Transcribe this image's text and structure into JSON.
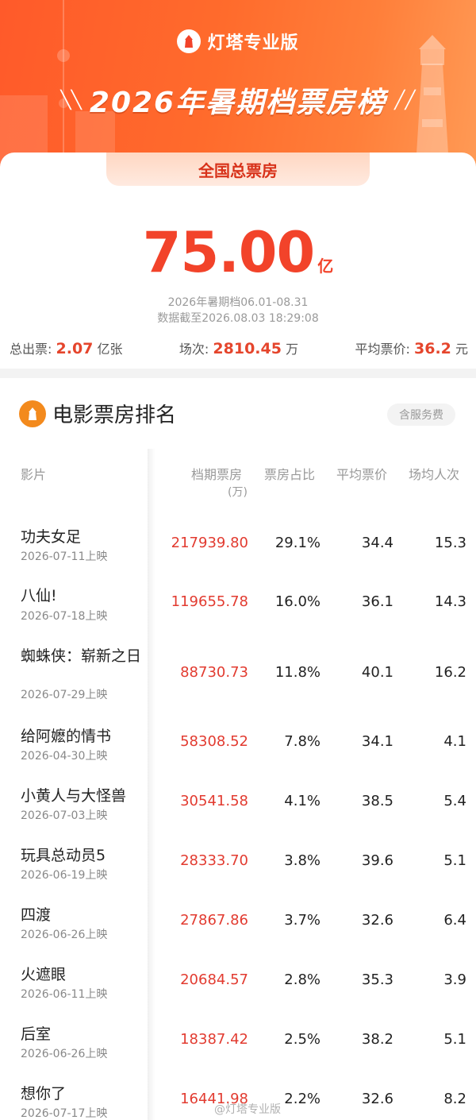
{
  "brand": {
    "name": "灯塔专业版",
    "logo_icon": "lighthouse-logo-icon"
  },
  "title": "2026年暑期档票房榜",
  "summary": {
    "tab": "全国总票房",
    "total_value": "75.00",
    "total_unit": "亿",
    "period": "2026年暑期档06.01-08.31",
    "as_of": "数据截至2026.08.03 18:29:08",
    "tickets_label": "总出票:",
    "tickets_value": "2.07",
    "tickets_unit": "亿张",
    "shows_label": "场次:",
    "shows_value": "2810.45",
    "shows_unit": "万",
    "avg_price_label": "平均票价:",
    "avg_price_value": "36.2",
    "avg_price_unit": "元"
  },
  "ranking": {
    "title": "电影票房排名",
    "fee_badge": "含服务费",
    "columns": {
      "film": "影片",
      "gross": "档期票房",
      "gross_unit": "(万)",
      "share": "票房占比",
      "avg_price": "平均票价",
      "avg_attendance": "场均人次"
    },
    "rows": [
      {
        "film": "功夫女足",
        "date": "2026-07-11上映",
        "gross": "217939.80",
        "share": "29.1%",
        "avg_price": "34.4",
        "avg_attendance": "15.3"
      },
      {
        "film": "八仙!",
        "date": "2026-07-18上映",
        "gross": "119655.78",
        "share": "16.0%",
        "avg_price": "36.1",
        "avg_attendance": "14.3"
      },
      {
        "film": "蜘蛛侠：崭新之日",
        "date": "2026-07-29上映",
        "gross": "88730.73",
        "share": "11.8%",
        "avg_price": "40.1",
        "avg_attendance": "16.2"
      },
      {
        "film": "给阿嬷的情书",
        "date": "2026-04-30上映",
        "gross": "58308.52",
        "share": "7.8%",
        "avg_price": "34.1",
        "avg_attendance": "4.1"
      },
      {
        "film": "小黄人与大怪兽",
        "date": "2026-07-03上映",
        "gross": "30541.58",
        "share": "4.1%",
        "avg_price": "38.5",
        "avg_attendance": "5.4"
      },
      {
        "film": "玩具总动员5",
        "date": "2026-06-19上映",
        "gross": "28333.70",
        "share": "3.8%",
        "avg_price": "39.6",
        "avg_attendance": "5.1"
      },
      {
        "film": "四渡",
        "date": "2026-06-26上映",
        "gross": "27867.86",
        "share": "3.7%",
        "avg_price": "32.6",
        "avg_attendance": "6.4"
      },
      {
        "film": "火遮眼",
        "date": "2026-06-11上映",
        "gross": "20684.57",
        "share": "2.8%",
        "avg_price": "35.3",
        "avg_attendance": "3.9"
      },
      {
        "film": "后室",
        "date": "2026-06-26上映",
        "gross": "18387.42",
        "share": "2.5%",
        "avg_price": "38.2",
        "avg_attendance": "5.1"
      },
      {
        "film": "想你了",
        "date": "2026-07-17上映",
        "gross": "16441.98",
        "share": "2.2%",
        "avg_price": "32.6",
        "avg_attendance": "8.2"
      }
    ]
  },
  "watermark": "@灯塔专业版",
  "colors": {
    "accent": "#f2432a",
    "banner": "#ff6b2c",
    "gross_text": "#e23b30"
  }
}
